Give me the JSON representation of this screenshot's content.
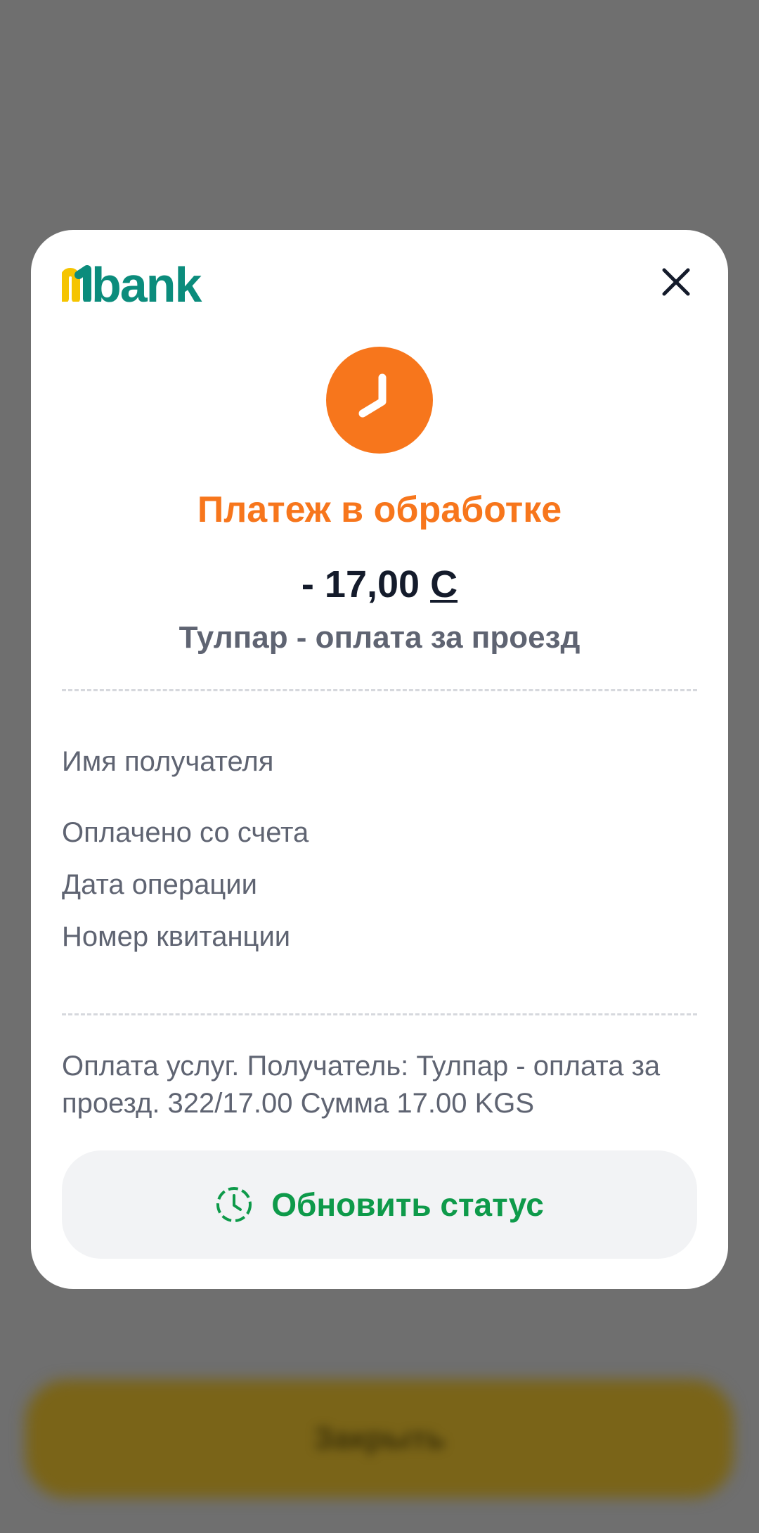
{
  "background": {
    "primary_button_label": "Закрыть"
  },
  "modal": {
    "logo_text": "bank",
    "status_title": "Платеж в обработке",
    "amount_value": "- 17,00",
    "currency_symbol": "С",
    "service_name": "Тулпар - оплата за проезд",
    "details": {
      "recipient_label": "Имя получателя",
      "paid_from_label": "Оплачено со счета",
      "date_label": "Дата операции",
      "receipt_label": "Номер квитанции"
    },
    "description": "Оплата услуг. Получатель: Тулпар - оплата за проезд. 322/17.00 Сумма 17.00 KGS",
    "refresh_button_label": "Обновить статус"
  },
  "colors": {
    "overlay": "#6f6f6f",
    "accent_orange": "#f7761c",
    "brand_teal": "#0b8c7c",
    "brand_yellow": "#f5c400",
    "action_green": "#0e9a4a"
  },
  "icons": {
    "status": "clock-icon",
    "close": "close-icon",
    "refresh": "clock-refresh-icon"
  }
}
